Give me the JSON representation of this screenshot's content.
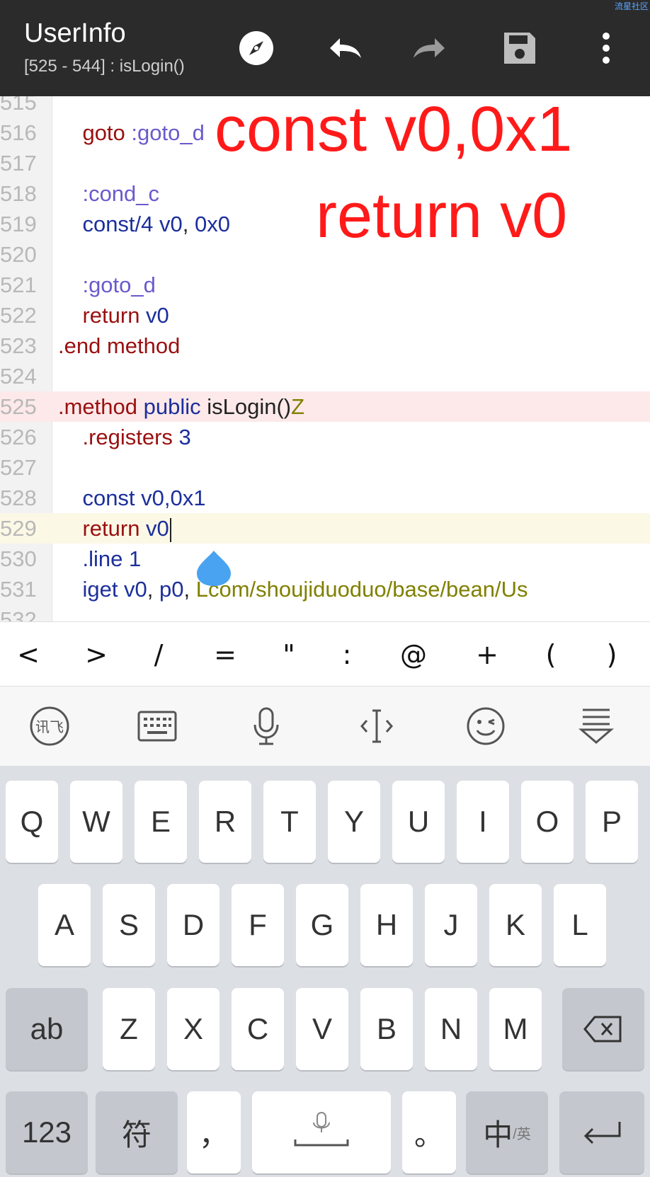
{
  "watermark": "流星社区",
  "appbar": {
    "title": "UserInfo",
    "subtitle": "[525 - 544] : isLogin()",
    "icons": [
      "compass-icon",
      "undo-icon",
      "redo-icon",
      "save-icon",
      "more-vert-icon"
    ]
  },
  "editor": {
    "lines": [
      {
        "n": "515",
        "segments": []
      },
      {
        "n": "516",
        "segments": [
          {
            "t": "    goto ",
            "c": "kw"
          },
          {
            "t": ":goto_d",
            "c": "lbl"
          }
        ]
      },
      {
        "n": "517",
        "segments": []
      },
      {
        "n": "518",
        "segments": [
          {
            "t": "    :cond_c",
            "c": "lbl"
          }
        ]
      },
      {
        "n": "519",
        "segments": [
          {
            "t": "    const/4 ",
            "c": "reg"
          },
          {
            "t": "v0",
            "c": "reg"
          },
          {
            "t": ", ",
            "c": "plain"
          },
          {
            "t": "0x0",
            "c": "num"
          }
        ]
      },
      {
        "n": "520",
        "segments": []
      },
      {
        "n": "521",
        "segments": [
          {
            "t": "    :goto_d",
            "c": "lbl"
          }
        ]
      },
      {
        "n": "522",
        "segments": [
          {
            "t": "    return ",
            "c": "kw"
          },
          {
            "t": "v0",
            "c": "reg"
          }
        ]
      },
      {
        "n": "523",
        "segments": [
          {
            "t": ".end method",
            "c": "kw"
          }
        ]
      },
      {
        "n": "524",
        "segments": []
      },
      {
        "n": "525",
        "segments": [
          {
            "t": ".method ",
            "c": "kw"
          },
          {
            "t": "public ",
            "c": "reg"
          },
          {
            "t": "isLogin()",
            "c": "plain"
          },
          {
            "t": "Z",
            "c": "typ"
          }
        ]
      },
      {
        "n": "526",
        "segments": [
          {
            "t": "    .registers ",
            "c": "kw"
          },
          {
            "t": "3",
            "c": "num"
          }
        ]
      },
      {
        "n": "527",
        "segments": []
      },
      {
        "n": "528",
        "segments": [
          {
            "t": "    const ",
            "c": "reg"
          },
          {
            "t": "v0,0x1",
            "c": "reg"
          }
        ]
      },
      {
        "n": "529",
        "segments": [
          {
            "t": "    return ",
            "c": "kw"
          },
          {
            "t": "v0",
            "c": "reg"
          }
        ]
      },
      {
        "n": "530",
        "segments": [
          {
            "t": "    .line ",
            "c": "reg"
          },
          {
            "t": "1",
            "c": "num"
          }
        ]
      },
      {
        "n": "531",
        "segments": [
          {
            "t": "    iget ",
            "c": "reg"
          },
          {
            "t": "v0",
            "c": "reg"
          },
          {
            "t": ", ",
            "c": "plain"
          },
          {
            "t": "p0",
            "c": "reg"
          },
          {
            "t": ", ",
            "c": "plain"
          },
          {
            "t": "Lcom/shoujiduoduo/base/bean/Us",
            "c": "typ"
          }
        ]
      },
      {
        "n": "532",
        "segments": []
      }
    ],
    "annotation_1": "const v0,0x1",
    "annotation_2": "return v0"
  },
  "symbols": [
    "<",
    ">",
    "/",
    "=",
    "\"",
    ":",
    "@",
    "+",
    "(",
    ")"
  ],
  "toolbar_icons": [
    "ime-logo-icon",
    "keyboard-icon",
    "microphone-icon",
    "cursor-move-icon",
    "emoji-icon",
    "hide-keyboard-icon"
  ],
  "keyboard": {
    "row1": [
      "Q",
      "W",
      "E",
      "R",
      "T",
      "Y",
      "U",
      "I",
      "O",
      "P"
    ],
    "row2": [
      "A",
      "S",
      "D",
      "F",
      "G",
      "H",
      "J",
      "K",
      "L"
    ],
    "row3": [
      "Z",
      "X",
      "C",
      "V",
      "B",
      "N",
      "M"
    ],
    "shift_label": "ab",
    "num_label": "123",
    "symbol_label": "符",
    "comma_label": "，",
    "period_label": "。",
    "lang_main": "中",
    "lang_sub": "/英"
  }
}
